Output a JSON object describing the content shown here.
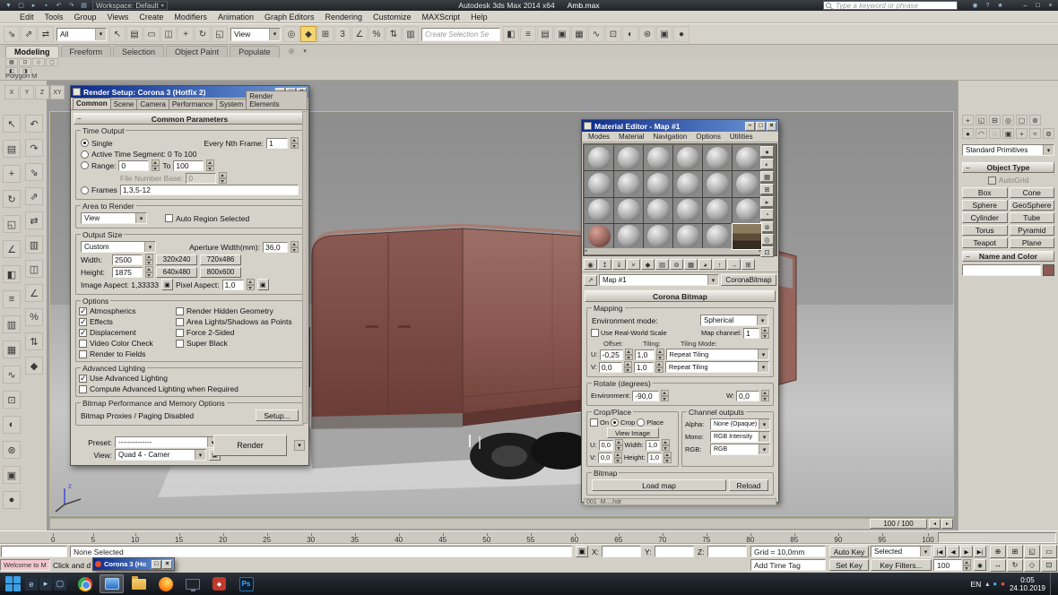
{
  "colors": {
    "viewport_border": "#d9c72f",
    "van_body": "#8a574f",
    "ui_chrome": "#d5d2c9",
    "dialog_title": "#0b2a8a",
    "taskbar": "#14171c"
  },
  "titlebar": {
    "workspace_label": "Workspace: Default",
    "title": "Autodesk 3ds Max 2014 x64",
    "filename": "Amb.max",
    "search_placeholder": "Type a keyword or phrase",
    "quick_icons": [
      {
        "n": "application-menu-icon",
        "g": "▼"
      },
      {
        "n": "new-scene-icon",
        "g": "▢"
      },
      {
        "n": "open-file-icon",
        "g": "▸"
      },
      {
        "n": "save-file-icon",
        "g": "▪"
      },
      {
        "n": "undo-icon",
        "g": "↶"
      },
      {
        "n": "redo-icon",
        "g": "↷"
      },
      {
        "n": "project-folder-icon",
        "g": "▤"
      }
    ],
    "right_icons": [
      {
        "n": "sign-in-icon",
        "g": "◉"
      },
      {
        "n": "help-icon",
        "g": "?"
      },
      {
        "n": "favorites-icon",
        "g": "★"
      }
    ],
    "window_icons": [
      {
        "n": "minimize-icon",
        "g": "–"
      },
      {
        "n": "maximize-icon",
        "g": "□"
      },
      {
        "n": "close-icon",
        "g": "×"
      }
    ]
  },
  "menubar": {
    "items": [
      "Edit",
      "Tools",
      "Group",
      "Views",
      "Create",
      "Modifiers",
      "Animation",
      "Graph Editors",
      "Rendering",
      "Customize",
      "MAXScript",
      "Help"
    ]
  },
  "main_toolbar": {
    "items": [
      {
        "t": "i",
        "n": "select-and-link-icon",
        "g": "⇘"
      },
      {
        "t": "i",
        "n": "unlink-selection-icon",
        "g": "⇗"
      },
      {
        "t": "i",
        "n": "bind-to-space-warp-icon",
        "g": "⇄"
      },
      {
        "t": "d",
        "n": "selection-filter-dropdown",
        "v": "All"
      },
      {
        "t": "i",
        "n": "select-object-icon",
        "g": "↖"
      },
      {
        "t": "i",
        "n": "select-by-name-icon",
        "g": "▤"
      },
      {
        "t": "i",
        "n": "rectangular-selection-region-icon",
        "g": "▭"
      },
      {
        "t": "i",
        "n": "window-crossing-toggle-icon",
        "g": "◫"
      },
      {
        "t": "i",
        "n": "select-and-move-icon",
        "g": "+"
      },
      {
        "t": "i",
        "n": "select-and-rotate-icon",
        "g": "↻"
      },
      {
        "t": "i",
        "n": "select-and-scale-icon",
        "g": "◱"
      },
      {
        "t": "d",
        "n": "reference-coordinate-system-dropdown",
        "v": "View"
      },
      {
        "t": "i",
        "n": "use-pivot-point-center-icon",
        "g": "◎"
      },
      {
        "t": "i",
        "n": "select-and-manipulate-icon",
        "g": "◆",
        "active": true
      },
      {
        "t": "i",
        "n": "keyboard-shortcut-override-icon",
        "g": "⊞"
      },
      {
        "t": "i",
        "n": "snaps-toggle-icon",
        "g": "3"
      },
      {
        "t": "i",
        "n": "angle-snap-toggle-icon",
        "g": "∠"
      },
      {
        "t": "i",
        "n": "percent-snap-toggle-icon",
        "g": "%"
      },
      {
        "t": "i",
        "n": "spinner-snap-toggle-icon",
        "g": "⇅"
      },
      {
        "t": "i",
        "n": "edit-named-selection-sets-icon",
        "g": "▥"
      },
      {
        "t": "in",
        "n": "named-selection-set-input",
        "v": "Create Selection Se"
      },
      {
        "t": "i",
        "n": "mirror-icon",
        "g": "◧"
      },
      {
        "t": "i",
        "n": "align-icon",
        "g": "≡"
      },
      {
        "t": "i",
        "n": "scene-explorer-icon",
        "g": "▤"
      },
      {
        "t": "i",
        "n": "layer-explorer-icon",
        "g": "▣"
      },
      {
        "t": "i",
        "n": "ribbon-toggle-icon",
        "g": "▦"
      },
      {
        "t": "i",
        "n": "curve-editor-icon",
        "g": "∿"
      },
      {
        "t": "i",
        "n": "schematic-view-icon",
        "g": "⊡"
      },
      {
        "t": "i",
        "n": "material-editor-icon",
        "g": "◐"
      },
      {
        "t": "i",
        "n": "render-setup-icon",
        "g": "⊛"
      },
      {
        "t": "i",
        "n": "rendered-frame-window-icon",
        "g": "▣"
      },
      {
        "t": "i",
        "n": "render-production-icon",
        "g": "●"
      }
    ]
  },
  "ribbon": {
    "tabs": [
      "Modeling",
      "Freeform",
      "Selection",
      "Object Paint",
      "Populate"
    ],
    "active": "Modeling",
    "panel_label": "Polygon M",
    "mini_icons": [
      {
        "n": "edit-poly-icon",
        "g": "▦"
      },
      {
        "n": "vertex-mode-icon",
        "g": "⊡"
      },
      {
        "n": "edge-mode-icon",
        "g": "◇"
      },
      {
        "n": "border-mode-icon",
        "g": "▢"
      },
      {
        "n": "polygon-mode-icon",
        "g": "◧"
      },
      {
        "n": "element-mode-icon",
        "g": "◨"
      }
    ],
    "collapse_icons": [
      {
        "n": "ribbon-config-icon",
        "g": "◎"
      },
      {
        "n": "ribbon-minimize-icon",
        "g": "▾"
      }
    ]
  },
  "mini_toolbar": {
    "icons": [
      {
        "n": "axis-x-constraint-icon",
        "g": "X"
      },
      {
        "n": "axis-y-constraint-icon",
        "g": "Y"
      },
      {
        "n": "axis-z-constraint-icon",
        "g": "Z"
      },
      {
        "n": "axis-plane-constraint-icon",
        "g": "XY"
      }
    ]
  },
  "left_toolbar": {
    "col1": [
      {
        "n": "select-object-icon",
        "g": "↖"
      },
      {
        "n": "select-by-name-icon",
        "g": "▤"
      },
      {
        "n": "select-and-move-icon",
        "g": "+"
      },
      {
        "n": "select-and-rotate-icon",
        "g": "↻"
      },
      {
        "n": "select-and-scale-icon",
        "g": "◱"
      },
      {
        "n": "snaps-toggle-icon",
        "g": "∠"
      },
      {
        "n": "mirror-icon",
        "g": "◧"
      },
      {
        "n": "align-icon",
        "g": "≡"
      },
      {
        "n": "layer-manager-icon",
        "g": "▥"
      },
      {
        "n": "graphite-ribbon-icon",
        "g": "▦"
      },
      {
        "n": "curve-editor-icon",
        "g": "∿"
      },
      {
        "n": "schematic-view-icon",
        "g": "⊡"
      },
      {
        "n": "material-editor-icon",
        "g": "◐"
      },
      {
        "n": "render-setup-icon",
        "g": "⊛"
      },
      {
        "n": "rendered-frame-icon",
        "g": "▣"
      },
      {
        "n": "render-icon",
        "g": "●"
      }
    ],
    "col2": [
      {
        "n": "undo-icon",
        "g": "↶"
      },
      {
        "n": "redo-icon",
        "g": "↷"
      },
      {
        "n": "select-and-link-icon",
        "g": "⇘"
      },
      {
        "n": "unlink-icon",
        "g": "⇗"
      },
      {
        "n": "bind-spacewarp-icon",
        "g": "⇄"
      },
      {
        "n": "named-sets-icon",
        "g": "▥"
      },
      {
        "n": "window-crossing-icon",
        "g": "◫"
      },
      {
        "n": "angle-snap-icon",
        "g": "∠"
      },
      {
        "n": "percent-snap-icon",
        "g": "%"
      },
      {
        "n": "spinner-snap-icon",
        "g": "⇅"
      },
      {
        "n": "manipulate-icon",
        "g": "◆"
      }
    ]
  },
  "viewport": {
    "frame_indicator": "100 / 100"
  },
  "render_setup": {
    "title": "Render Setup: Corona 3 (Hotfix 2)",
    "tabs": [
      "Common",
      "Scene",
      "Camera",
      "Performance",
      "System",
      "Render Elements"
    ],
    "active_tab": "Common",
    "rollout": "Common Parameters",
    "time_output": {
      "legend": "Time Output",
      "single": "Single",
      "every_nth_label": "Every Nth Frame:",
      "every_nth_value": "1",
      "active_segment": "Active Time Segment:  0 To 100",
      "range_label": "Range:",
      "range_from": "0",
      "to_label": "To",
      "range_to": "100",
      "file_number_label": "File Number Base:",
      "file_number_value": "0",
      "frames_label": "Frames",
      "frames_value": "1,3,5-12"
    },
    "area": {
      "legend": "Area to Render",
      "value": "View",
      "auto_region": "Auto Region Selected"
    },
    "output": {
      "legend": "Output Size",
      "value": "Custom",
      "aperture_label": "Aperture Width(mm):",
      "aperture_value": "36,0",
      "width_label": "Width:",
      "width_value": "2500",
      "height_label": "Height:",
      "height_value": "1875",
      "preset_buttons": [
        "320x240",
        "720x486",
        "640x480",
        "800x600"
      ],
      "image_aspect": "Image Aspect: 1,33333",
      "pixel_aspect_label": "Pixel Aspect:",
      "pixel_aspect_value": "1,0"
    },
    "options": {
      "legend": "Options",
      "left": [
        {
          "label": "Atmospherics",
          "checked": true
        },
        {
          "label": "Effects",
          "checked": true
        },
        {
          "label": "Displacement",
          "checked": true
        },
        {
          "label": "Video Color Check",
          "checked": false
        },
        {
          "label": "Render to Fields",
          "checked": false
        }
      ],
      "right": [
        {
          "label": "Render Hidden Geometry",
          "checked": false
        },
        {
          "label": "Area Lights/Shadows as Points",
          "checked": false
        },
        {
          "label": "Force 2-Sided",
          "checked": false
        },
        {
          "label": "Super Black",
          "checked": false
        }
      ]
    },
    "advanced": {
      "legend": "Advanced Lighting",
      "items": [
        {
          "label": "Use Advanced Lighting",
          "checked": true
        },
        {
          "label": "Compute Advanced Lighting when Required",
          "checked": false
        }
      ]
    },
    "bitmap_perf": {
      "legend": "Bitmap Performance and Memory Options",
      "text": "Bitmap Proxies / Paging Disabled",
      "setup": "Setup..."
    },
    "preset_label": "Preset:",
    "preset_value": "--------------",
    "view_label": "View:",
    "view_value": "Quad 4 - Camer",
    "render_button": "Render"
  },
  "material_editor": {
    "title": "Material Editor - Map #1",
    "menus": [
      "Modes",
      "Material",
      "Navigation",
      "Options",
      "Utilities"
    ],
    "spheres": {
      "count": 24,
      "maroon": [
        18
      ],
      "selected": 23
    },
    "side_icons": [
      {
        "n": "sample-type-icon",
        "g": "●"
      },
      {
        "n": "backlight-icon",
        "g": "◐"
      },
      {
        "n": "background-icon",
        "g": "▦"
      },
      {
        "n": "sample-uv-tiling-icon",
        "g": "⊞"
      },
      {
        "n": "video-color-check-icon",
        "g": "▸"
      },
      {
        "n": "make-preview-icon",
        "g": "◔"
      },
      {
        "n": "material-options-icon",
        "g": "⊛"
      },
      {
        "n": "select-by-material-icon",
        "g": "◎"
      },
      {
        "n": "material-map-navigator-icon",
        "g": "⊡"
      }
    ],
    "tool_icons": [
      {
        "n": "get-material-icon",
        "g": "◉"
      },
      {
        "n": "put-material-icon",
        "g": "↥"
      },
      {
        "n": "assign-material-icon",
        "g": "⇓"
      },
      {
        "n": "reset-map-icon",
        "g": "×"
      },
      {
        "n": "make-unique-icon",
        "g": "◆"
      },
      {
        "n": "put-to-library-icon",
        "g": "▤"
      },
      {
        "n": "material-id-icon",
        "g": "⊚"
      },
      {
        "n": "show-map-in-viewport-icon",
        "g": "▦"
      },
      {
        "n": "show-end-result-icon",
        "g": "◕"
      },
      {
        "n": "go-to-parent-icon",
        "g": "↑"
      },
      {
        "n": "go-forward-icon",
        "g": "→"
      },
      {
        "n": "sample-uv-icon",
        "g": "⊞"
      }
    ],
    "pick_icon": "↗",
    "map_name": "Map #1",
    "map_type": "CoronaBitmap",
    "rollout": "Corona Bitmap",
    "mapping": {
      "legend": "Mapping",
      "env_mode_label": "Environment mode:",
      "env_mode_value": "Spherical",
      "real_world": "Use Real-World Scale",
      "map_channel_label": "Map channel:",
      "map_channel_value": "1",
      "offset_label": "Offset:",
      "tiling_label": "Tiling:",
      "tiling_mode_label": "Tiling Mode:",
      "u_label": "U:",
      "u_offset": "-0,25",
      "u_tiling": "1,0",
      "u_mode": "Repeat Tiling",
      "v_label": "V:",
      "v_offset": "0,0",
      "v_tiling": "1,0",
      "v_mode": "Repeat Tiling"
    },
    "rotate": {
      "legend": "Rotate (degrees)",
      "env_label": "Environment:",
      "env_value": "-90,0",
      "w_label": "W:",
      "w_value": "0,0"
    },
    "crop": {
      "legend": "Crop/Place",
      "on": "On",
      "crop": "Crop",
      "place": "Place",
      "view_image": "View Image",
      "u_label": "U:",
      "u_value": "0,0",
      "w_label": "Width:",
      "w_value": "1,0",
      "v_label": "V:",
      "v_value": "0,0",
      "h_label": "Height:",
      "h_value": "1,0"
    },
    "channels": {
      "legend": "Channel outputs",
      "alpha_label": "Alpha:",
      "alpha_value": "None (Opaque)",
      "mono_label": "Mono:",
      "mono_value": "RGB Intensity",
      "rgb_label": "RGB:",
      "rgb_value": "RGB"
    },
    "bitmap": {
      "legend": "Bitmap",
      "load": "Load map",
      "reload": "Reload",
      "path_partial": "001_M....hdr"
    }
  },
  "command_panel": {
    "tab_icons": [
      {
        "n": "create-tab-icon",
        "g": "+"
      },
      {
        "n": "modify-tab-icon",
        "g": "◱"
      },
      {
        "n": "hierarchy-tab-icon",
        "g": "⊟"
      },
      {
        "n": "motion-tab-icon",
        "g": "◎"
      },
      {
        "n": "display-tab-icon",
        "g": "▢"
      },
      {
        "n": "utilities-tab-icon",
        "g": "⊛"
      }
    ],
    "category_icons": [
      {
        "n": "geometry-icon",
        "g": "●"
      },
      {
        "n": "shapes-icon",
        "g": "◠"
      },
      {
        "n": "lights-icon",
        "g": "◌"
      },
      {
        "n": "cameras-icon",
        "g": "▣"
      },
      {
        "n": "helpers-icon",
        "g": "+"
      },
      {
        "n": "spacewarps-icon",
        "g": "≈"
      },
      {
        "n": "systems-icon",
        "g": "⊚"
      }
    ],
    "dropdown": "Standard Primitives",
    "object_type": "Object Type",
    "autogrid": "AutoGrid",
    "buttons": [
      "Box",
      "Cone",
      "Sphere",
      "GeoSphere",
      "Cylinder",
      "Tube",
      "Torus",
      "Pyramid",
      "Teapot",
      "Plane"
    ],
    "name_color": "Name and Color",
    "object_color": "#8b5a52"
  },
  "trackbar": {
    "ticks": [
      "0",
      "5",
      "10",
      "15",
      "20",
      "25",
      "30",
      "35",
      "40",
      "45",
      "50",
      "55",
      "60",
      "65",
      "70",
      "75",
      "80",
      "85",
      "90",
      "95",
      "100"
    ]
  },
  "statusbar": {
    "listener_text": "Welcome to M",
    "selection": "None Selected",
    "prompt": "Click and d",
    "x": "X:",
    "y": "Y:",
    "z": "Z:",
    "grid": "Grid = 10,0mm",
    "add_time_tag": "Add Time Tag",
    "auto_key": "Auto Key",
    "selected": "Selected",
    "set_key": "Set Key",
    "key_filters": "Key Filters...",
    "frame": "100"
  },
  "playback": {
    "row1": [
      {
        "n": "go-to-start-icon",
        "g": "|◀"
      },
      {
        "n": "previous-frame-icon",
        "g": "◀"
      },
      {
        "n": "play-icon",
        "g": "▶"
      },
      {
        "n": "go-to-end-icon",
        "g": "▶|"
      }
    ],
    "key_mode_icon": "◉"
  },
  "viewport_nav": {
    "icons": [
      {
        "n": "zoom-icon",
        "g": "⊕"
      },
      {
        "n": "zoom-all-icon",
        "g": "⊞"
      },
      {
        "n": "zoom-extents-icon",
        "g": "◱"
      },
      {
        "n": "zoom-region-icon",
        "g": "▭"
      },
      {
        "n": "pan-icon",
        "g": "↔"
      },
      {
        "n": "orbit-icon",
        "g": "↻"
      },
      {
        "n": "fov-icon",
        "g": "◇"
      },
      {
        "n": "maximize-viewport-icon",
        "g": "⊡"
      }
    ]
  },
  "corona_min": {
    "title": "Corona 3 (Ho"
  },
  "taskbar": {
    "lang": "EN",
    "time": "0:05",
    "date": "24.10.2019",
    "quick_icons": [
      {
        "n": "ie-icon",
        "g": "e"
      },
      {
        "n": "media-player-icon",
        "g": "▸"
      },
      {
        "n": "show-desktop-icon",
        "g": "▢"
      }
    ],
    "app_icons": [
      {
        "n": "chrome-icon"
      },
      {
        "n": "explorer-icon",
        "active": true
      },
      {
        "n": "folder-icon"
      },
      {
        "n": "firefox-icon"
      },
      {
        "n": "monitor-app-icon"
      },
      {
        "n": "red-app-icon",
        "label": "◆"
      },
      {
        "n": "photoshop-icon",
        "label": "Ps"
      }
    ],
    "tray_icons": [
      {
        "n": "tray-up-icon",
        "g": "▴"
      },
      {
        "n": "tray-blue-icon",
        "g": "●"
      },
      {
        "n": "tray-red-icon",
        "g": "●"
      }
    ]
  }
}
